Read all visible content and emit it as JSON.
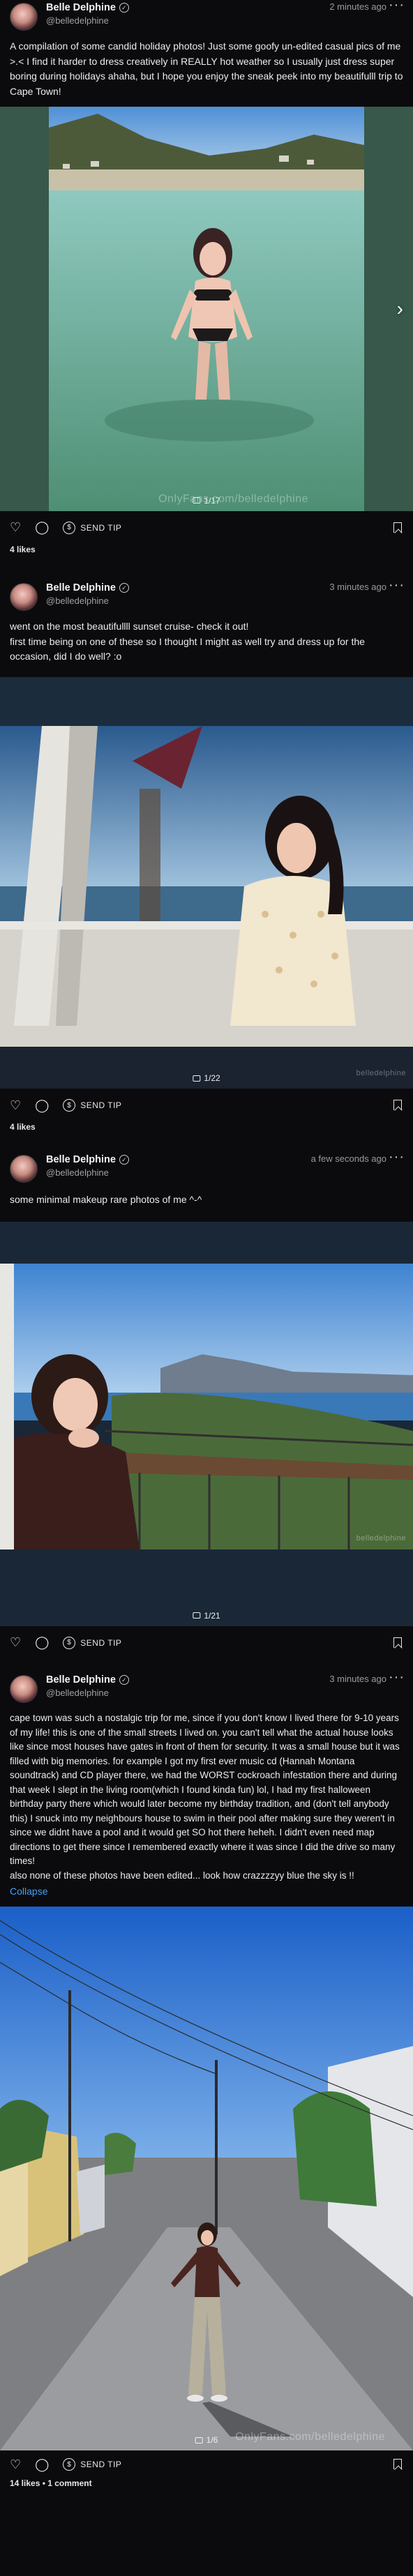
{
  "posts": [
    {
      "name": "Belle Delphine",
      "handle": "@belledelphine",
      "time": "2 minutes ago",
      "text": "A compilation of some candid holiday photos! Just some goofy un-edited casual pics of me >.< I find it harder to dress creatively in REALLY hot weather so I usually just dress super boring during holidays ahaha, but I hope you enjoy the sneak peek into my beautifulll trip to Cape Town!",
      "counter": "1/17",
      "watermark": "OnlyFans.com/belledelphine",
      "send_tip": "SEND TIP",
      "likes": "4 likes"
    },
    {
      "name": "Belle Delphine",
      "handle": "@belledelphine",
      "time": "3 minutes ago",
      "text": "went on the most beautifullll sunset cruise- check it out!\nfirst time being on one of these so I thought I might as well try and dress up for the occasion, did I do well? :o",
      "counter": "1/22",
      "watermark": "belledelphine",
      "send_tip": "SEND TIP",
      "likes": "4 likes"
    },
    {
      "name": "Belle Delphine",
      "handle": "@belledelphine",
      "time": "a few seconds ago",
      "text": "some minimal makeup rare photos of me ^-^",
      "counter": "1/21",
      "watermark": "belledelphine",
      "send_tip": "SEND TIP",
      "likes": ""
    },
    {
      "name": "Belle Delphine",
      "handle": "@belledelphine",
      "time": "3 minutes ago",
      "text": "cape town was such a nostalgic trip for me, since if you don't know I lived there for 9-10 years of my life! this is one of the small streets I lived on. you can't tell what the actual house looks like since most houses have gates in front of them for security. It was a small house but it was filled with big memories. for example I got my first ever music cd (Hannah Montana soundtrack) and CD player there, we had the WORST cockroach infestation there and during that week I slept in the living room(which I found kinda fun) lol, I had my first halloween birthday party there which would later become my birthday tradition, and (don't tell anybody this) I snuck into my neighbours house to swim in their pool after making sure they weren't in since we didnt have a pool and it would get SO hot there heheh. I didn't even need map directions to get there since I remembered exactly where it was since I did the drive so many times!\nalso none of these photos have been edited... look how crazzzzyy blue the sky is !!",
      "collapse": "Collapse",
      "counter": "1/6",
      "watermark": "OnlyFans.com/belledelphine",
      "send_tip": "SEND TIP",
      "likes": "14 likes • 1 comment"
    }
  ],
  "icons": {
    "like": "heart-icon",
    "comment": "comment-icon",
    "tip": "dollar-circle-icon",
    "bookmark": "bookmark-icon",
    "more": "more-horizontal-icon",
    "verified": "verified-badge-icon",
    "next": "chevron-right-icon"
  },
  "colors": {
    "background": "#0b0b0d",
    "link": "#3ea2ff"
  }
}
